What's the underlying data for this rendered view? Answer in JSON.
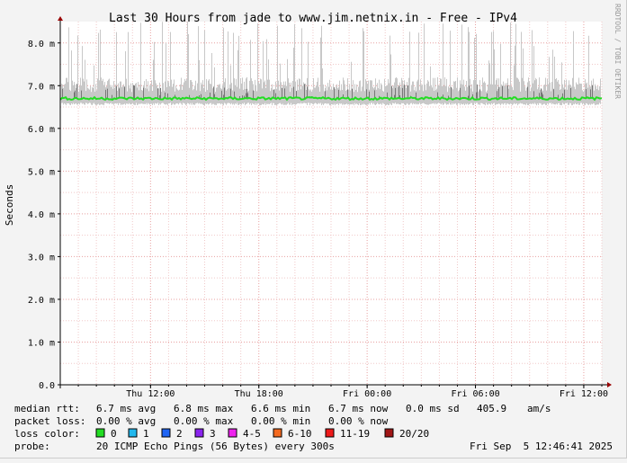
{
  "chart_data": {
    "type": "area",
    "title": "Last 30 Hours from jade to www.jim.netnix.in - Free - IPv4",
    "ylabel": "Seconds",
    "watermark": "RRDTOOL / TOBI OETIKER",
    "y_ticks": [
      {
        "value": 0.0,
        "label": "0.0"
      },
      {
        "value": 1.0,
        "label": "1.0 m"
      },
      {
        "value": 2.0,
        "label": "2.0 m"
      },
      {
        "value": 3.0,
        "label": "3.0 m"
      },
      {
        "value": 4.0,
        "label": "4.0 m"
      },
      {
        "value": 5.0,
        "label": "5.0 m"
      },
      {
        "value": 6.0,
        "label": "6.0 m"
      },
      {
        "value": 7.0,
        "label": "7.0 m"
      },
      {
        "value": 8.0,
        "label": "8.0 m"
      }
    ],
    "ylim": [
      0,
      8.5
    ],
    "xlim_hours": [
      0,
      30
    ],
    "x_ticks": [
      {
        "hour": 5,
        "label": "Thu 12:00"
      },
      {
        "hour": 11,
        "label": "Thu 18:00"
      },
      {
        "hour": 17,
        "label": "Fri 00:00"
      },
      {
        "hour": 23,
        "label": "Fri 06:00"
      },
      {
        "hour": 29,
        "label": "Fri 12:00"
      }
    ],
    "median_rtt_ms": 6.7,
    "series": [
      {
        "name": "median rtt",
        "color": "#22dd22",
        "level": 6.7
      },
      {
        "name": "ping spread",
        "color": "#c8c8c8"
      }
    ],
    "grid": true,
    "colors": {
      "canvas": "#ffffff",
      "background": "#f3f3f3",
      "major_grid": "#e8a0a0",
      "minor_grid": "#f0c8c8",
      "axis": "#000000",
      "spike": "#c8c8c8",
      "dense": "#777777",
      "median": "#22dd22"
    }
  },
  "legend": {
    "median_rtt": {
      "label": "median rtt:",
      "avg": "6.7 ms avg",
      "max": "6.8 ms max",
      "min": "6.6 ms min",
      "now": "6.7 ms now",
      "sd": "0.0 ms sd",
      "am": "405.9",
      "am_unit": "am/s"
    },
    "packet_loss": {
      "label": "packet loss:",
      "avg": "0.00 % avg",
      "max": "0.00 % max",
      "min": "0.00 % min",
      "now": "0.00 % now"
    },
    "loss_color": {
      "label": "loss color:",
      "items": [
        {
          "label": "0",
          "color": "#22dd22"
        },
        {
          "label": "1",
          "color": "#22b8ee"
        },
        {
          "label": "2",
          "color": "#1e64f4"
        },
        {
          "label": "3",
          "color": "#8a24ee"
        },
        {
          "label": "4-5",
          "color": "#ee22ee"
        },
        {
          "label": "6-10",
          "color": "#f46a20"
        },
        {
          "label": "11-19",
          "color": "#ee1a1a"
        },
        {
          "label": "20/20",
          "color": "#a01414"
        }
      ]
    },
    "probe": {
      "label": "probe:",
      "value": "20 ICMP Echo Pings (56 Bytes) every 300s",
      "timestamp": "Fri Sep  5 12:46:41 2025"
    }
  }
}
